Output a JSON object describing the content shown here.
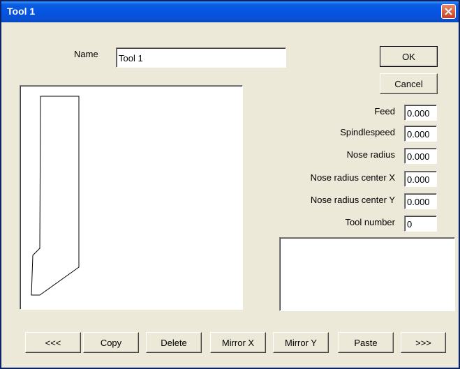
{
  "window": {
    "title": "Tool 1"
  },
  "icons": {
    "close": "close-x-icon"
  },
  "name_field": {
    "label": "Name",
    "value": "Tool 1"
  },
  "buttons": {
    "ok": "OK",
    "cancel": "Cancel"
  },
  "params": [
    {
      "label": "Feed",
      "value": "0.000"
    },
    {
      "label": "Spindlespeed",
      "value": "0.000"
    },
    {
      "label": "Nose radius",
      "value": "0.000"
    },
    {
      "label": "Nose radius center X",
      "value": "0.000"
    },
    {
      "label": "Nose radius center Y",
      "value": "0.000"
    },
    {
      "label": "Tool number",
      "value": "0"
    }
  ],
  "bottom_buttons": [
    "<<<",
    "Copy",
    "Delete",
    "Mirror X",
    "Mirror Y",
    "Paste",
    ">>>"
  ],
  "colors": {
    "title_bar": "#0554e3",
    "face": "#ece9d8",
    "close": "#c83e20"
  }
}
